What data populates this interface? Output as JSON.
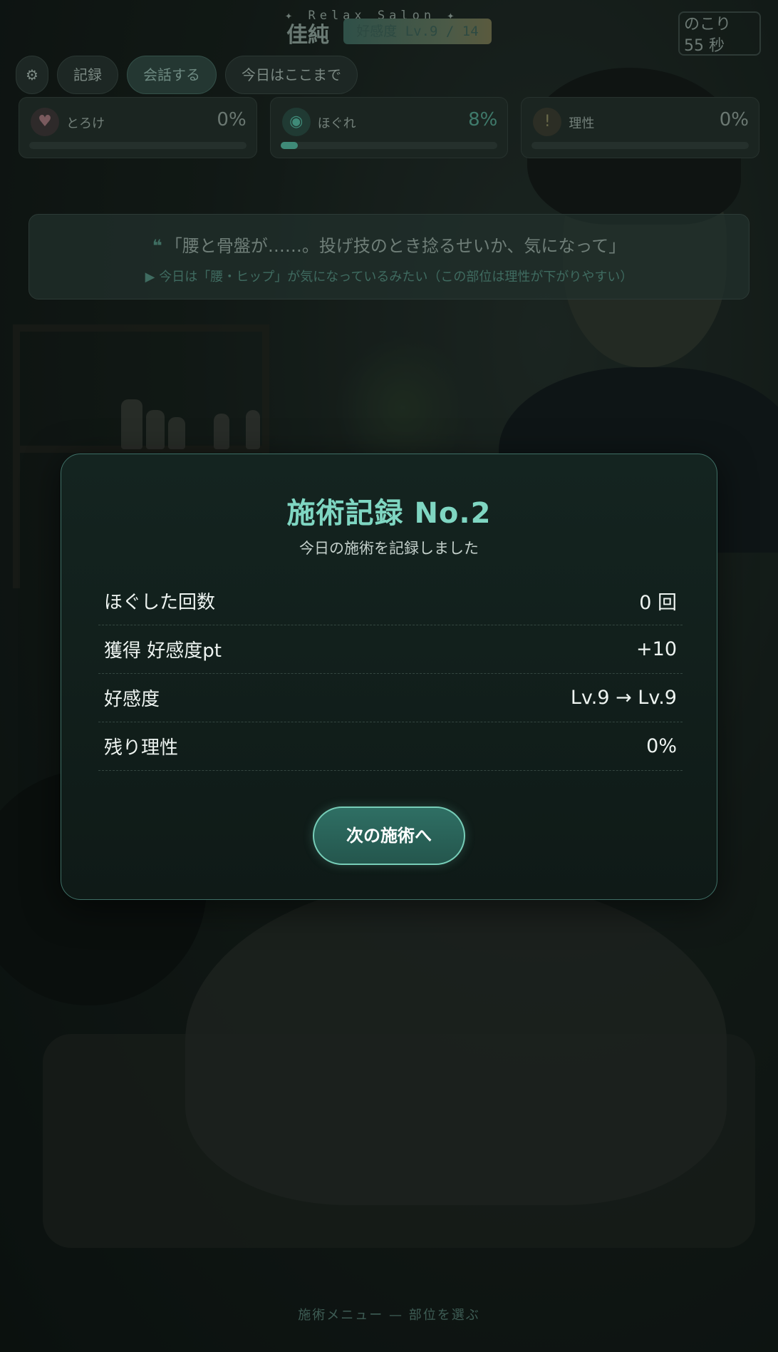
{
  "header": {
    "salon_tag": "✦ Relax Salon ✦",
    "character_name": "佳純",
    "affinity_badge": "好感度 Lv.9 / 14",
    "timer": "のこり 55 秒"
  },
  "toolbar": {
    "settings_icon": "gear-icon",
    "settings_glyph": "⚙",
    "record_label": "記録",
    "talk_label": "会話する",
    "end_label": "今日はここまで"
  },
  "meters": [
    {
      "label": "とろけ",
      "value_text": "0%",
      "fill": 0,
      "icon": "heart-icon",
      "glyph": "♥"
    },
    {
      "label": "ほぐれ",
      "value_text": "8%",
      "fill": 0.08,
      "icon": "target-icon",
      "glyph": "◉"
    },
    {
      "label": "理性",
      "value_text": "0%",
      "fill": 0,
      "icon": "exclamation-icon",
      "glyph": "!"
    }
  ],
  "dialogue": {
    "quote_mark": "❝",
    "quote": "「腰と骨盤が……。投げ技のとき捻るせいか、気になって」",
    "hint": "▶ 今日は「腰・ヒップ」が気になっているみたい（この部位は理性が下がりやすい）"
  },
  "modal": {
    "title": "施術記録 No.2",
    "subtitle": "今日の施術を記録しました",
    "stats": [
      {
        "label": "ほぐした回数",
        "value": "0 回"
      },
      {
        "label": "獲得 好感度pt",
        "value": "+10"
      },
      {
        "label": "好感度",
        "value": "Lv.9 → Lv.9"
      },
      {
        "label": "残り理性",
        "value": "0%"
      }
    ],
    "next_button": "次の施術へ"
  },
  "footer": {
    "hint": "施術メニュー — 部位を選ぶ"
  },
  "colors": {
    "accent": "#7fd6c2",
    "button_bg": "#2f6f64",
    "modal_border": "#3f6f66",
    "meter_fill": "#3f8a78"
  }
}
